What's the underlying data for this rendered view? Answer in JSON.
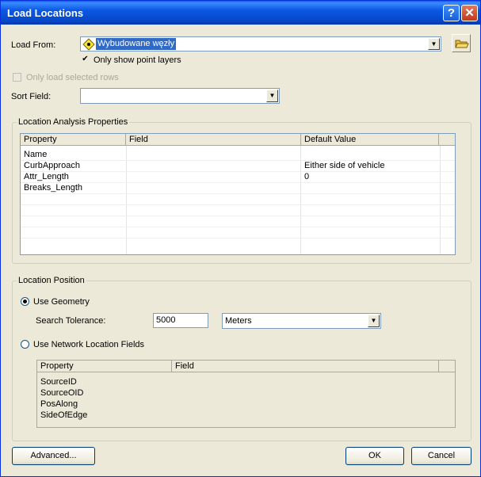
{
  "window": {
    "title": "Load Locations"
  },
  "load_from": {
    "label": "Load From:",
    "value": "Wybudowane węzły",
    "only_points_label": "Only show point layers"
  },
  "only_selected_label": "Only load selected rows",
  "sort_field": {
    "label": "Sort Field:",
    "value": ""
  },
  "analysis": {
    "title": "Location Analysis Properties",
    "headers": [
      "Property",
      "Field",
      "Default Value"
    ],
    "rows": [
      [
        "Name",
        "",
        ""
      ],
      [
        "CurbApproach",
        "",
        "Either side of vehicle"
      ],
      [
        "Attr_Length",
        "",
        "0"
      ],
      [
        "Breaks_Length",
        "",
        ""
      ]
    ]
  },
  "position": {
    "title": "Location Position",
    "use_geometry_label": "Use Geometry",
    "tolerance_label": "Search Tolerance:",
    "tolerance_value": "5000",
    "units_value": "Meters",
    "use_network_label": "Use Network Location Fields",
    "headers": [
      "Property",
      "Field"
    ],
    "rows": [
      "SourceID",
      "SourceOID",
      "PosAlong",
      "SideOfEdge"
    ]
  },
  "buttons": {
    "advanced": "Advanced...",
    "ok": "OK",
    "cancel": "Cancel"
  },
  "colors": {
    "title_bar": "#0b58e2",
    "dialog_bg": "#ece9d8",
    "selection": "#316ac5"
  }
}
